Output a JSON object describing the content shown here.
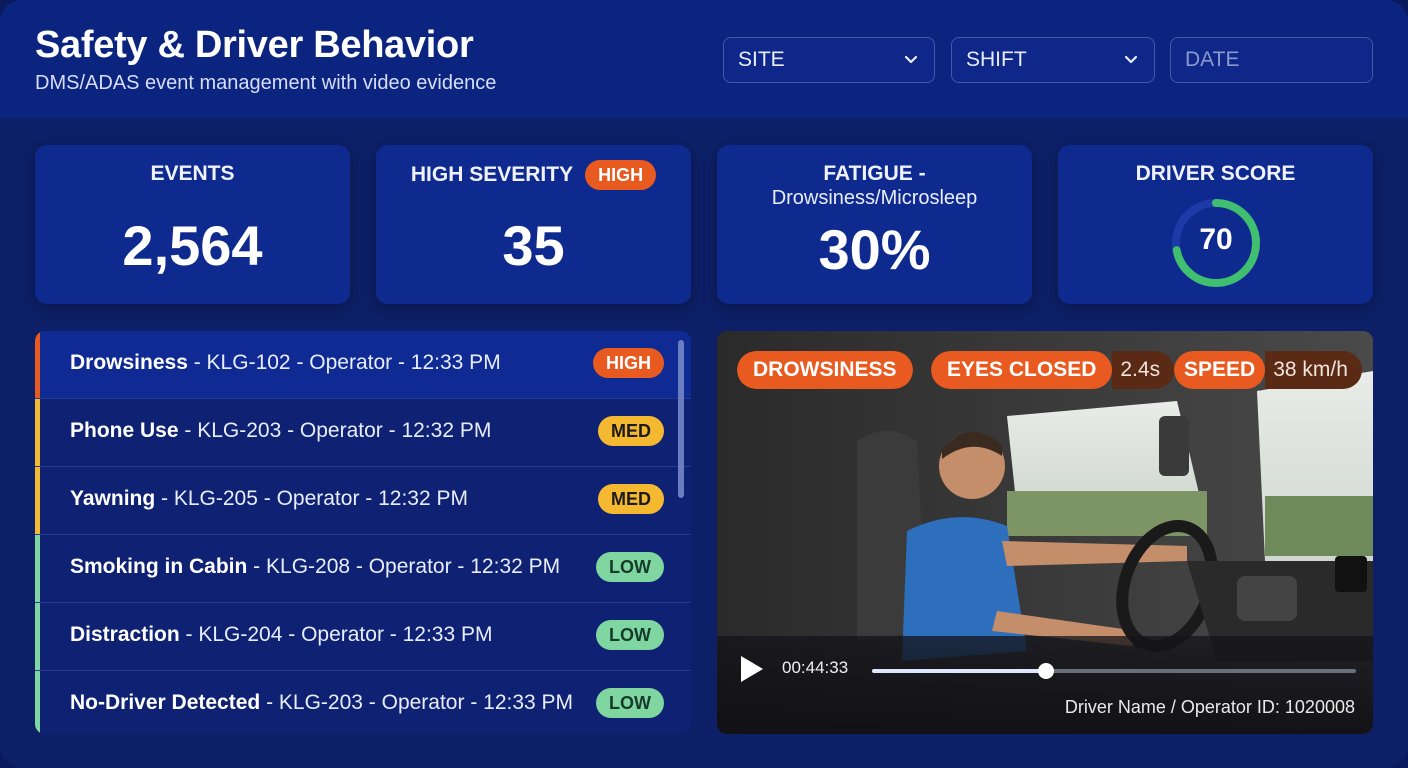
{
  "header": {
    "title": "Safety & Driver Behavior",
    "subtitle": "DMS/ADAS event management with video evidence"
  },
  "filters": {
    "site": "SITE",
    "shift": "SHIFT",
    "date_placeholder": "DATE"
  },
  "kpis": {
    "events": {
      "label": "EVENTS",
      "value": "2,564"
    },
    "high_severity": {
      "label": "HIGH SEVERITY",
      "badge": "HIGH",
      "value": "35"
    },
    "fatigue": {
      "label": "FATIGUE -",
      "sublabel": "Drowsiness/Microsleep",
      "value": "30%"
    },
    "driver_score": {
      "label": "DRIVER SCORE",
      "value": "70",
      "progress": 0.72
    }
  },
  "events": [
    {
      "type": "Drowsiness",
      "details": " - KLG-102 - Operator - 12:33 PM",
      "severity": "HIGH",
      "color": "#e85a1f"
    },
    {
      "type": "Phone Use",
      "details": " - KLG-203 - Operator - 12:32 PM",
      "severity": "MED",
      "color": "#f5b831"
    },
    {
      "type": "Yawning",
      "details": " - KLG-205 - Operator - 12:32 PM",
      "severity": "MED",
      "color": "#f5b831"
    },
    {
      "type": "Smoking in Cabin",
      "details": " - KLG-208 - Operator - 12:32 PM",
      "severity": "LOW",
      "color": "#7fd6a1"
    },
    {
      "type": "Distraction",
      "details": " - KLG-204 - Operator - 12:33 PM",
      "severity": "LOW",
      "color": "#7fd6a1"
    },
    {
      "type": "No-Driver Detected",
      "details": " - KLG-203 - Operator - 12:33 PM",
      "severity": "LOW",
      "color": "#7fd6a1"
    }
  ],
  "video": {
    "tags": {
      "event": "DROWSINESS",
      "eyes_label": "EYES CLOSED",
      "eyes_value": "2.4s",
      "speed_label": "SPEED",
      "speed_value": "38 km/h"
    },
    "time": "00:44:33",
    "progress": 0.36,
    "driver_id": "Driver Name / Operator ID: 1020008"
  },
  "colors": {
    "high": "#e85a1f",
    "med": "#f5b831",
    "low": "#7fd6a1",
    "score_ring": "#3fbf6f"
  }
}
